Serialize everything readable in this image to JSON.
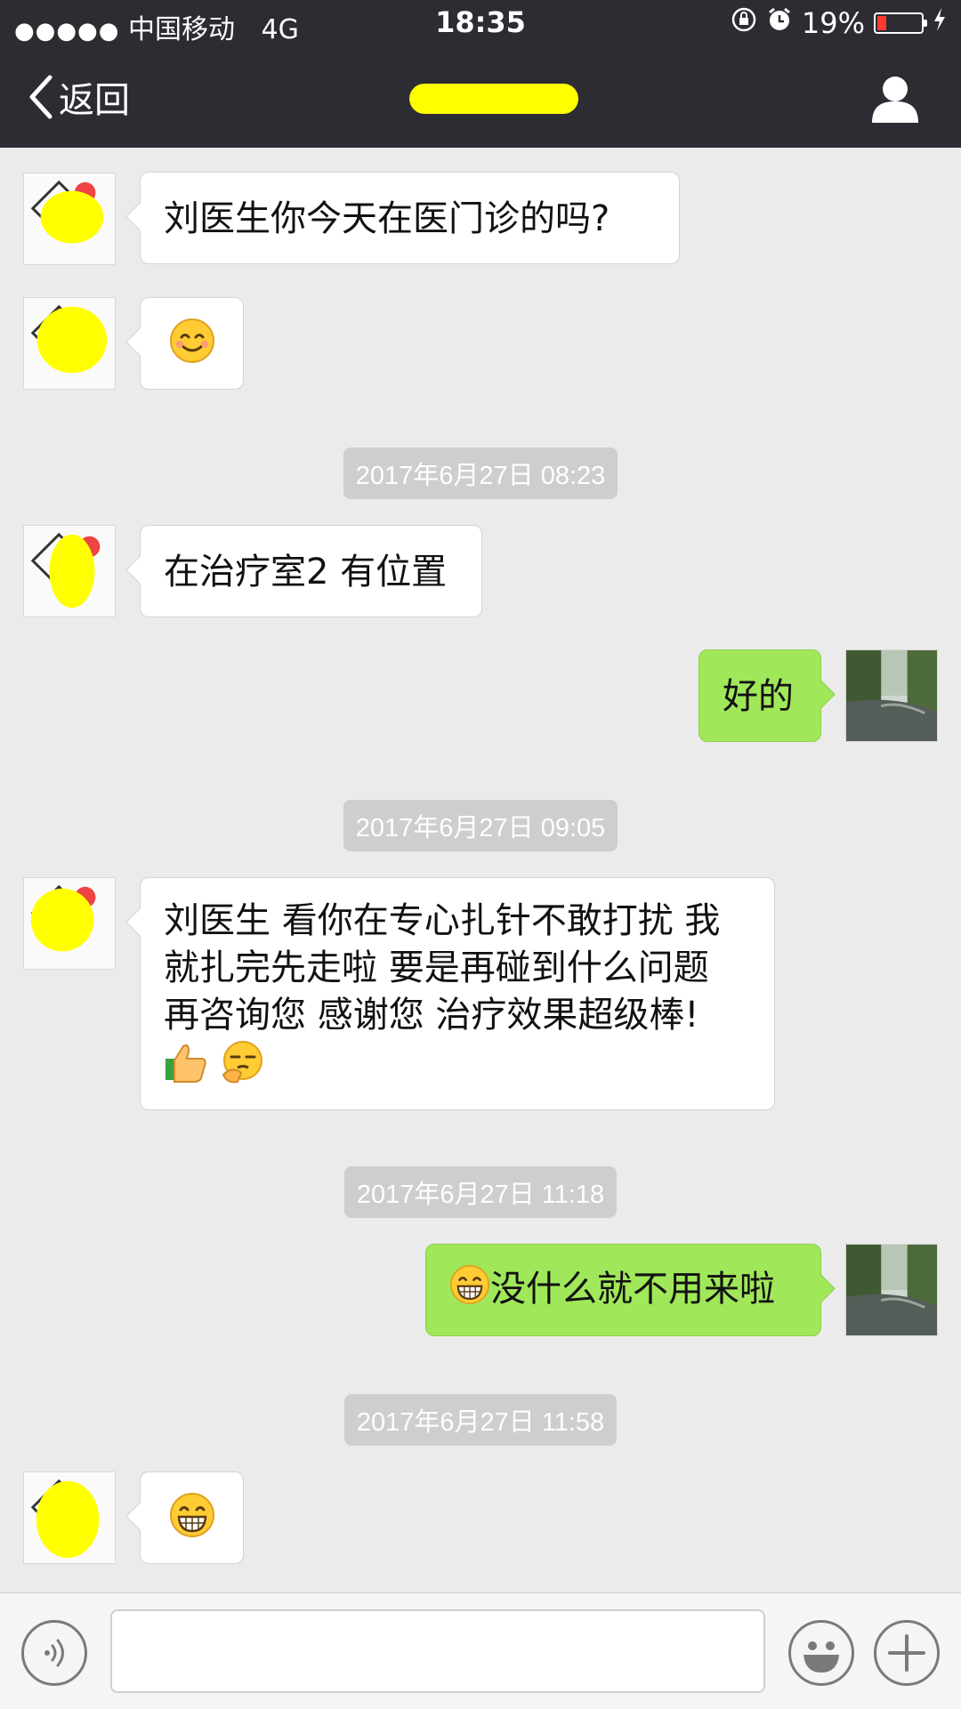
{
  "status_bar": {
    "signal_dots": "●●●●●",
    "carrier": "中国移动",
    "network": "4G",
    "time": "18:35",
    "battery_percent": "19%",
    "battery_level": 0.19,
    "battery_color": "#ff3b30"
  },
  "nav": {
    "back_label": "返回",
    "title": ""
  },
  "messages": {
    "m1": "刘医生你今天在医门诊的吗?",
    "m2_emoji": "smile-emoji",
    "ts1": "2017年6月27日 08:23",
    "m3": "在治疗室2 有位置",
    "m4": "好的",
    "ts2": "2017年6月27日 09:05",
    "m5_line1": "刘医生 看你在专心扎针不敢打扰 我",
    "m5_line2": "就扎完先走啦 要是再碰到什么问题",
    "m5_line3": "再咨询您 感谢您 治疗效果超级棒!",
    "m5_emojis": [
      "thumbs-up-emoji",
      "thinking-emoji"
    ],
    "ts3": "2017年6月27日 11:18",
    "m6": "没什么就不用来啦",
    "m6_emoji": "grin-emoji",
    "ts4": "2017年6月27日 11:58",
    "m7_emoji": "grin-emoji"
  },
  "input": {
    "value": ""
  },
  "colors": {
    "header_bg": "#2d2c32",
    "chat_bg": "#ebebeb",
    "sent_bubble": "#a0e75a",
    "received_bubble": "#ffffff",
    "timestamp_bg": "#cecece"
  }
}
